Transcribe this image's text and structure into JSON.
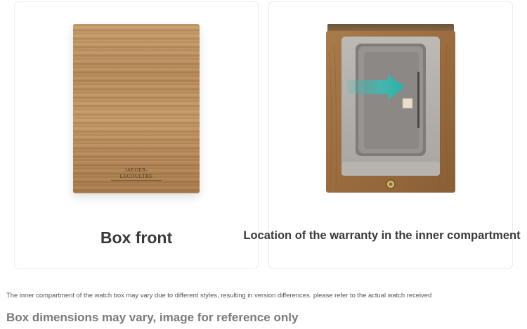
{
  "cards": {
    "left": {
      "caption": "Box front",
      "logo_text": "JAEGER-LECOULTRE"
    },
    "right": {
      "caption": "Location of the warranty in the inner compartment"
    }
  },
  "footer": {
    "note": "The inner compartment of the watch box may vary due to different styles, resulting in version differences. please refer to the actual watch received",
    "disclaimer": "Box dimensions may vary, image for reference only"
  },
  "colors": {
    "wood": "#b88c5b",
    "felt": "#a9a6a2",
    "arrow": "#35c0b6",
    "caption_text": "#3a3a3a",
    "disclaimer_text": "#7a7a7a"
  }
}
